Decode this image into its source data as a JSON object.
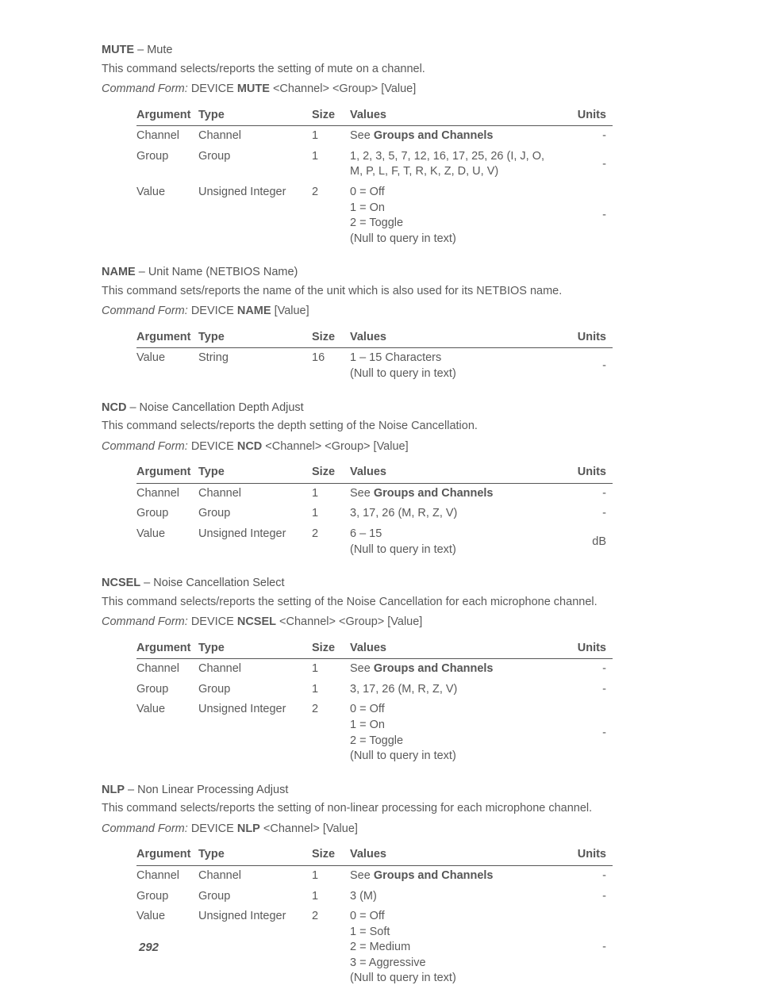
{
  "page_number": "292",
  "headers": {
    "argument": "Argument",
    "type": "Type",
    "size": "Size",
    "values": "Values",
    "units": "Units"
  },
  "cf_label": "Command Form:",
  "see_prefix": "See ",
  "see_link": "Groups and Channels",
  "sections": [
    {
      "cmd": "MUTE",
      "name": "Mute",
      "desc": "This command selects/reports the setting of mute on a channel.",
      "device": "DEVICE",
      "cf_cmd": "MUTE",
      "cf_args": "<Channel> <Group> [Value]",
      "rows": [
        {
          "arg": "Channel",
          "type": "Channel",
          "size": "1",
          "values": [
            "__SEE__"
          ],
          "units": "-"
        },
        {
          "arg": "Group",
          "type": "Group",
          "size": "1",
          "values": [
            "1, 2, 3, 5, 7, 12, 16, 17, 25, 26 (I, J, O, M, P, L, F, T, R, K, Z, D, U, V)"
          ],
          "units": "-"
        },
        {
          "arg": "Value",
          "type": "Unsigned Integer",
          "size": "2",
          "values": [
            "0 = Off",
            "1 = On",
            "2 = Toggle",
            "(Null to query in text)"
          ],
          "units": "-"
        }
      ]
    },
    {
      "cmd": "NAME",
      "name": "Unit Name (NETBIOS Name)",
      "desc": "This command sets/reports the name of the unit which is also used for its NETBIOS name.",
      "device": "DEVICE",
      "cf_cmd": "NAME",
      "cf_args": "[Value]",
      "rows": [
        {
          "arg": "Value",
          "type": "String",
          "size": "16",
          "values": [
            "1 – 15 Characters",
            "(Null to query in text)"
          ],
          "units": "-"
        }
      ]
    },
    {
      "cmd": "NCD",
      "name": "Noise Cancellation Depth Adjust",
      "desc": "This command selects/reports the depth setting of the Noise Cancellation.",
      "device": "DEVICE",
      "cf_cmd": "NCD",
      "cf_args": "<Channel> <Group> [Value]",
      "rows": [
        {
          "arg": "Channel",
          "type": "Channel",
          "size": "1",
          "values": [
            "__SEE__"
          ],
          "units": "-"
        },
        {
          "arg": "Group",
          "type": "Group",
          "size": "1",
          "values": [
            "3, 17, 26 (M, R, Z, V)"
          ],
          "units": "-"
        },
        {
          "arg": "Value",
          "type": "Unsigned Integer",
          "size": "2",
          "values": [
            "6 – 15",
            "(Null to query in text)"
          ],
          "units": "dB"
        }
      ]
    },
    {
      "cmd": "NCSEL",
      "name": "Noise Cancellation Select",
      "desc": "This command selects/reports the setting of the Noise Cancellation for each microphone channel.",
      "device": "DEVICE",
      "cf_cmd": "NCSEL",
      "cf_args": "<Channel> <Group> [Value]",
      "rows": [
        {
          "arg": "Channel",
          "type": "Channel",
          "size": "1",
          "values": [
            "__SEE__"
          ],
          "units": "-"
        },
        {
          "arg": "Group",
          "type": "Group",
          "size": "1",
          "values": [
            "3, 17, 26 (M, R, Z, V)"
          ],
          "units": "-"
        },
        {
          "arg": "Value",
          "type": "Unsigned Integer",
          "size": "2",
          "values": [
            "0 = Off",
            "1 = On",
            "2 = Toggle",
            "(Null to query in text)"
          ],
          "units": "-"
        }
      ]
    },
    {
      "cmd": "NLP",
      "name": "Non Linear Processing Adjust",
      "desc": "This command selects/reports the setting of non-linear processing for each microphone channel.",
      "device": "DEVICE",
      "cf_cmd": "NLP",
      "cf_args": "<Channel> [Value]",
      "rows": [
        {
          "arg": "Channel",
          "type": "Channel",
          "size": "1",
          "values": [
            "__SEE__"
          ],
          "units": "-"
        },
        {
          "arg": "Group",
          "type": "Group",
          "size": "1",
          "values": [
            "3 (M)"
          ],
          "units": "-"
        },
        {
          "arg": "Value",
          "type": "Unsigned Integer",
          "size": "2",
          "values": [
            "0 = Off",
            "1 = Soft",
            "2 = Medium",
            "3 = Aggressive",
            "(Null to query in text)"
          ],
          "units": "-"
        }
      ]
    }
  ]
}
